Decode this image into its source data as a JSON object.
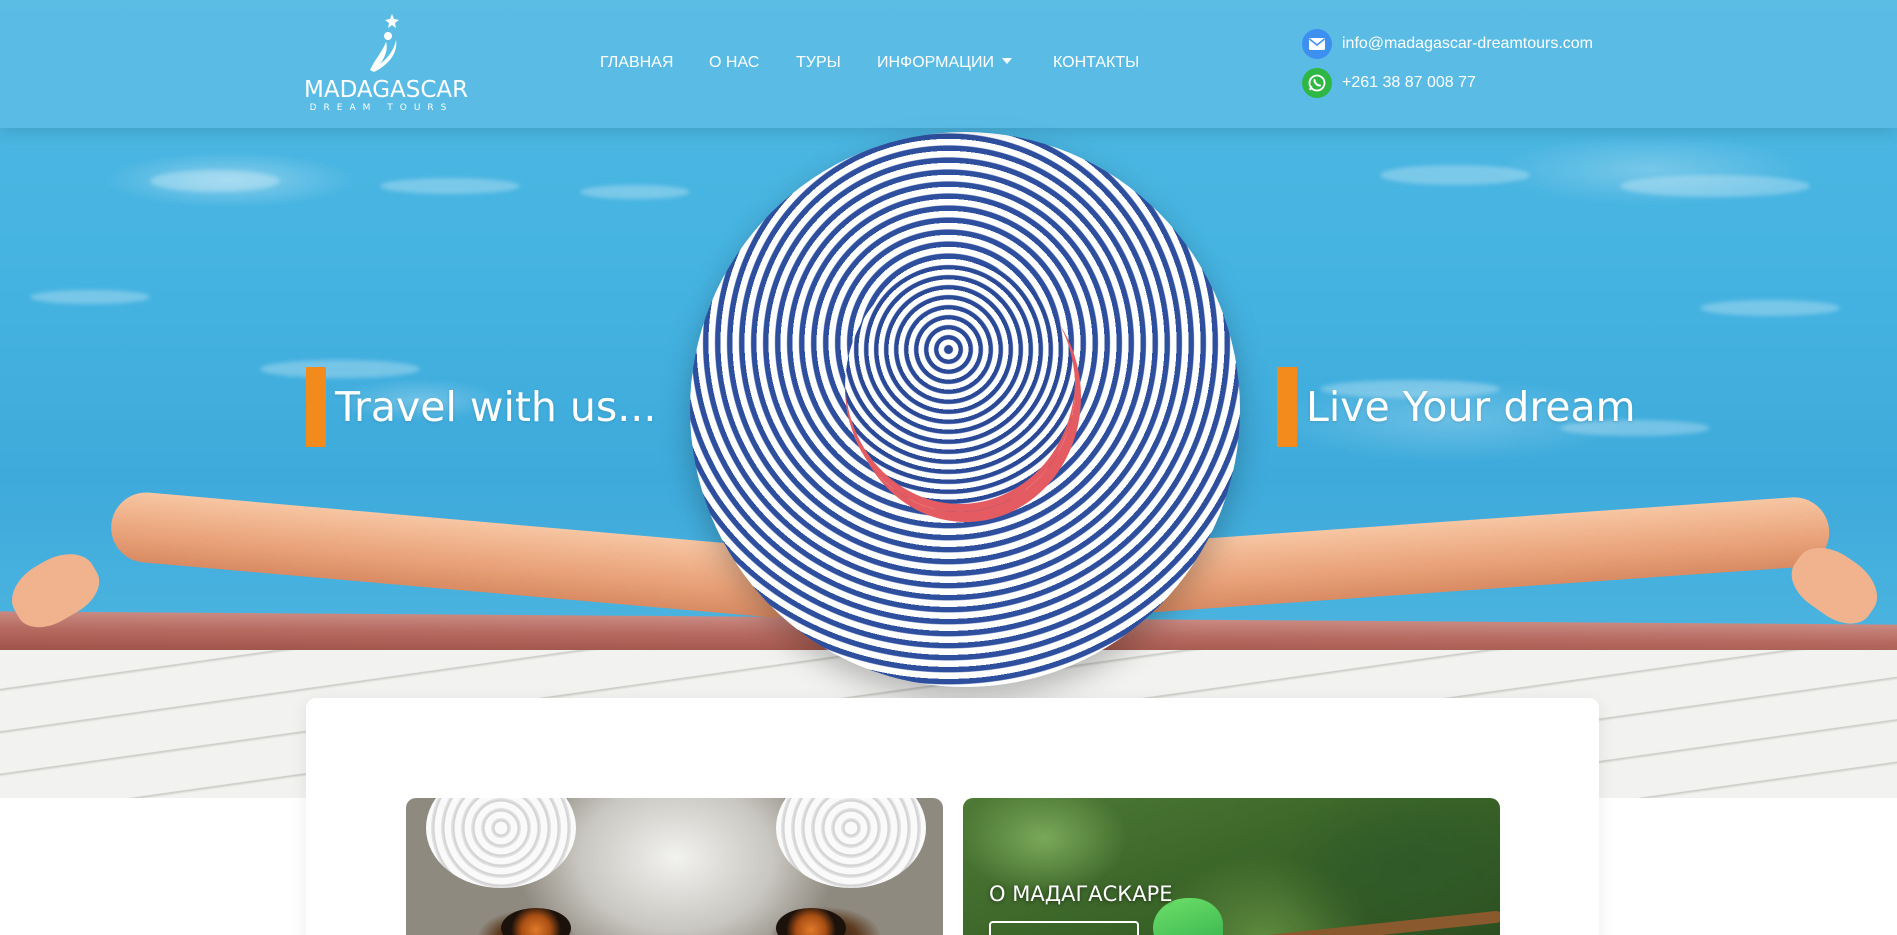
{
  "header": {
    "logo": {
      "title": "MADAGASCAR",
      "subtitle": "DREAM TOURS"
    },
    "nav": [
      {
        "label": "ГЛАВНАЯ"
      },
      {
        "label": "О НАС"
      },
      {
        "label": "ТУРЫ"
      },
      {
        "label": "ИНФОРМАЦИИ",
        "has_dropdown": true
      },
      {
        "label": "КОНТАКТЫ"
      }
    ],
    "contacts": {
      "email": {
        "icon": "mail-icon",
        "text": "info@madagascar-dreamtours.com",
        "color": "#3d8ff0"
      },
      "phone": {
        "icon": "whatsapp-icon",
        "text": "+261 38 87 008 77",
        "color": "#2fb745"
      }
    }
  },
  "hero": {
    "left_tagline": "Travel with us...",
    "right_tagline": "Live Your dream",
    "accent_color": "#f28a1c"
  },
  "tiles": [
    {
      "title": ""
    },
    {
      "title": "О МАДАГАСКАРЕ"
    }
  ]
}
